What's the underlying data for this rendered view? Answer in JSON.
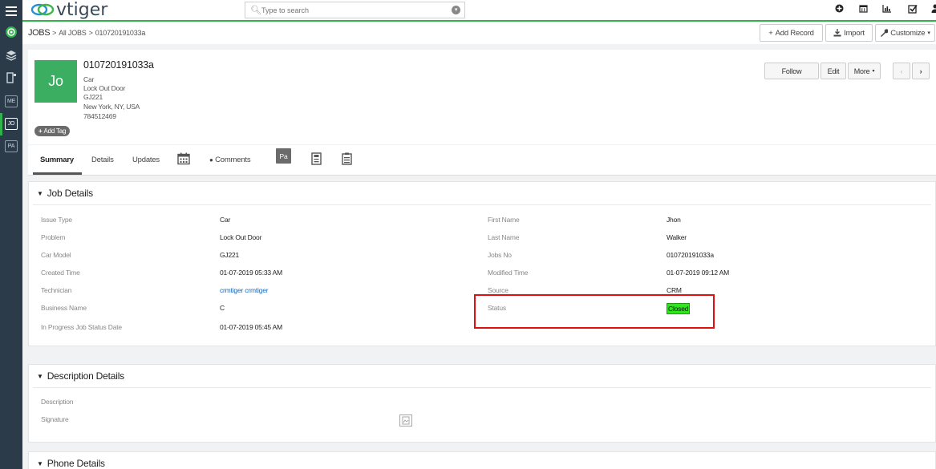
{
  "app": {
    "logo_text": "vtiger",
    "search_placeholder": "Type to search"
  },
  "nav": {
    "items": [
      {
        "name": "menu",
        "icon": "hamburger-icon"
      },
      {
        "name": "home",
        "icon": "target-icon"
      },
      {
        "name": "inventory",
        "icon": "layers-icon"
      },
      {
        "name": "mobile",
        "icon": "mobile-icon"
      },
      {
        "name": "me",
        "label": "ME"
      },
      {
        "name": "jo",
        "label": "JO"
      },
      {
        "name": "pa",
        "label": "PA"
      }
    ]
  },
  "topbar": {
    "icons": [
      "plus-circle-icon",
      "calendar-icon",
      "chart-icon",
      "checkbox-icon",
      "user-icon"
    ]
  },
  "breadcrumb": {
    "module": "JOBS",
    "sep1": ">",
    "list": "All JOBS",
    "sep2": ">",
    "record": "010720191033a"
  },
  "toolbar": {
    "add_record": "Add Record",
    "import": "Import",
    "customize": "Customize"
  },
  "record": {
    "avatar": "Jo",
    "title": "010720191033a",
    "lines": [
      "Car",
      "Lock Out Door",
      "GJ221",
      "New York, NY, USA",
      "784512469"
    ],
    "add_tag": "Add Tag",
    "follow": "Follow",
    "edit": "Edit",
    "more": "More"
  },
  "tabs": {
    "summary": "Summary",
    "details": "Details",
    "updates": "Updates",
    "comments": "Comments",
    "pa": "Pa"
  },
  "job_details": {
    "title": "Job Details",
    "left": [
      {
        "label": "Issue Type",
        "value": "Car"
      },
      {
        "label": "Problem",
        "value": "Lock Out Door"
      },
      {
        "label": "Car Model",
        "value": "GJ221"
      },
      {
        "label": "Created Time",
        "value": "01-07-2019 05:33 AM"
      },
      {
        "label": "Technician",
        "value": "crmtiger crmtiger"
      },
      {
        "label": "Business Name",
        "value": "C"
      },
      {
        "label": "In Progress Job Status Date",
        "value": "01-07-2019 05:45 AM"
      }
    ],
    "right": [
      {
        "label": "First Name",
        "value": "Jhon"
      },
      {
        "label": "Last Name",
        "value": "Walker"
      },
      {
        "label": "Jobs No",
        "value": "010720191033a"
      },
      {
        "label": "Modified Time",
        "value": "01-07-2019 09:12 AM"
      },
      {
        "label": "Source",
        "value": "CRM"
      },
      {
        "label": "Status",
        "value": "Closed"
      }
    ]
  },
  "description_details": {
    "title": "Description Details",
    "description_label": "Description",
    "signature_label": "Signature"
  },
  "phone_details": {
    "title": "Phone Details"
  },
  "colors": {
    "accent": "#2fb34a",
    "avatar": "#3cae62",
    "status_closed": "#2ee51e",
    "highlight_box": "#e01010",
    "nav_bg": "#2c3b49"
  }
}
